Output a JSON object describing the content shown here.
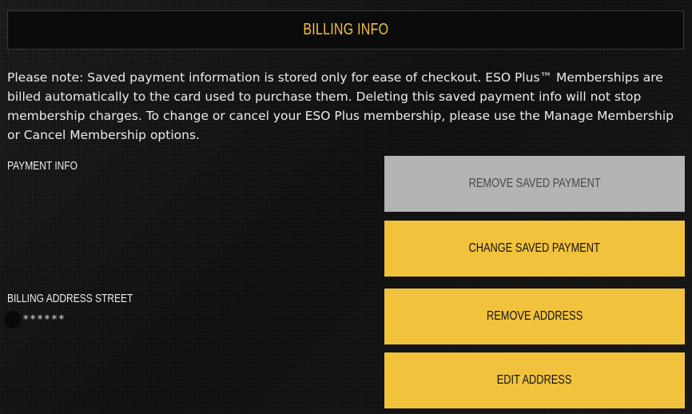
{
  "header": {
    "title": "Billing Info"
  },
  "note": {
    "text": "Please note: Saved payment information is stored only for ease of checkout. ESO Plus™ Memberships are billed automatically to the card used to purchase them. Deleting this saved payment info will not stop membership charges. To change or cancel your ESO Plus membership, please use the Manage Membership or Cancel Membership options."
  },
  "payment": {
    "label": "Payment Info",
    "remove_label": "Remove Saved Payment",
    "change_label": "Change Saved Payment"
  },
  "billing_address": {
    "label": "Billing Address Street",
    "value": "******",
    "remove_label": "Remove Address",
    "edit_label": "Edit Address"
  },
  "colors": {
    "accent": "#f1c23c",
    "disabled": "#b4b4b4",
    "background": "#121212"
  }
}
